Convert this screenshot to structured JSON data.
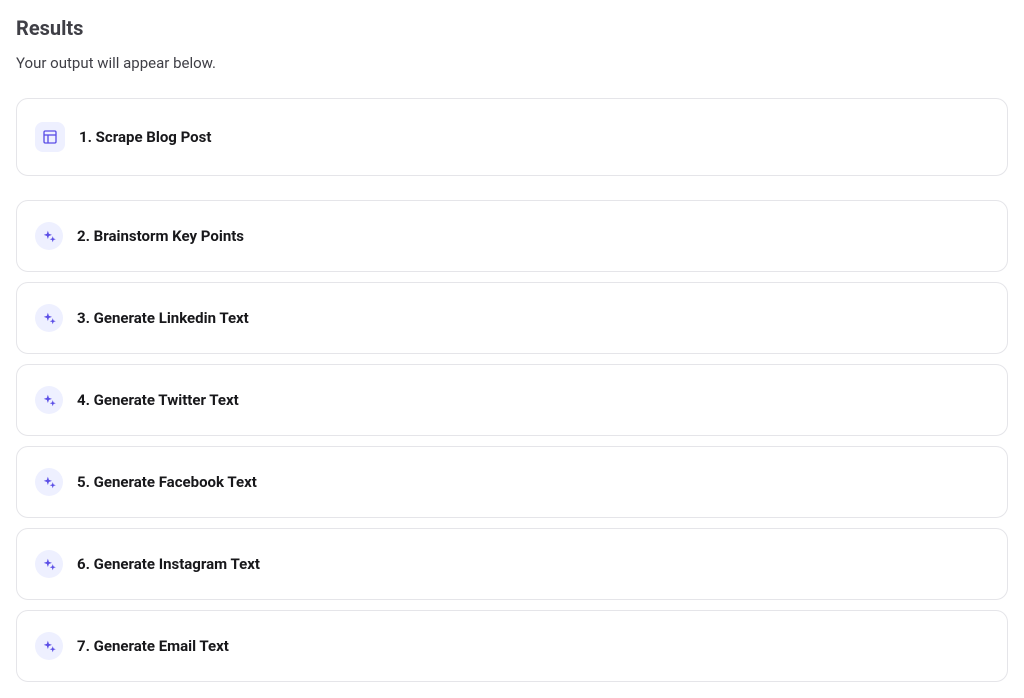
{
  "results": {
    "title": "Results",
    "subtitle": "Your output will appear below.",
    "steps": [
      {
        "label": "1. Scrape Blog Post",
        "icon": "layout-icon"
      },
      {
        "label": "2. Brainstorm Key Points",
        "icon": "sparkle-icon"
      },
      {
        "label": "3. Generate Linkedin Text",
        "icon": "sparkle-icon"
      },
      {
        "label": "4. Generate Twitter Text",
        "icon": "sparkle-icon"
      },
      {
        "label": "5. Generate Facebook Text",
        "icon": "sparkle-icon"
      },
      {
        "label": "6. Generate Instagram Text",
        "icon": "sparkle-icon"
      },
      {
        "label": "7. Generate Email Text",
        "icon": "sparkle-icon"
      }
    ]
  },
  "colors": {
    "accent": "#5b4ee6",
    "iconBg": "#eef0ff",
    "border": "#e5e5e9",
    "text": "#18181b",
    "subtext": "#3f3f46"
  }
}
